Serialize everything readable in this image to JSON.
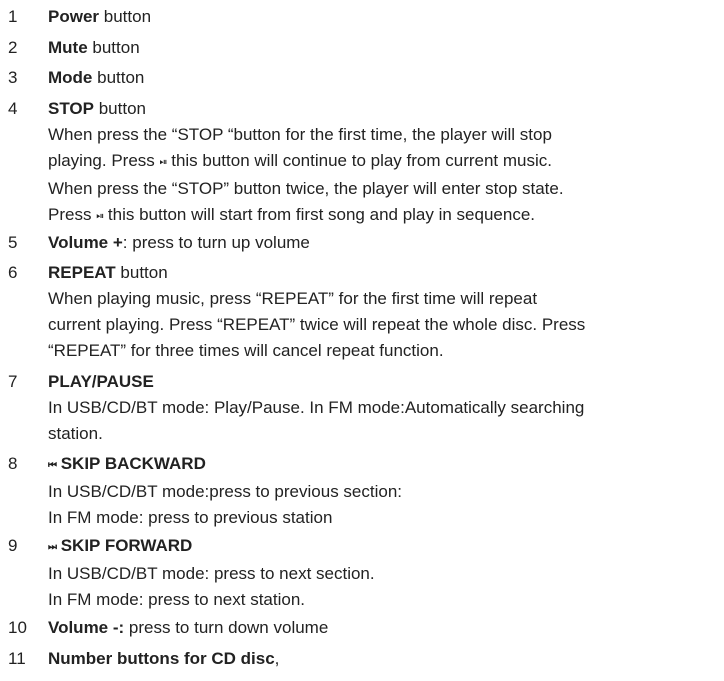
{
  "items": [
    {
      "num": "1",
      "bold": "Power",
      "rest": " button"
    },
    {
      "num": "2",
      "bold": "Mute",
      "rest": " button"
    },
    {
      "num": "3",
      "bold": "Mode",
      "rest": " button"
    },
    {
      "num": "4",
      "bold": "STOP",
      "rest": " button",
      "desc": [
        "When press the “STOP “button for the first time, the player will stop",
        [
          "playing. Press ",
          "⏯",
          " this button will continue to play from current music."
        ],
        " When press the “STOP” button twice, the player will enter stop state.",
        [
          "Press ",
          "⏯",
          " this button will start from first song and play in sequence."
        ]
      ]
    },
    {
      "num": "5",
      "bold": "Volume +",
      "rest": ": press to turn up volume"
    },
    {
      "num": "6",
      "bold": "REPEAT",
      "rest": " button",
      "desc": [
        "When playing music, press “REPEAT” for the first time will repeat",
        "current playing. Press “REPEAT” twice will repeat the whole disc. Press",
        "“REPEAT” for three times will cancel repeat function."
      ]
    },
    {
      "num": "7",
      "bold": "PLAY/PAUSE",
      "rest": "",
      "desc": [
        "In USB/CD/BT mode: Play/Pause. In FM mode:Automatically searching",
        "station."
      ]
    },
    {
      "num": "8",
      "icon": "⏮",
      "bold": " SKIP BACKWARD",
      "rest": "",
      "desc": [
        "In USB/CD/BT mode:press to previous section:",
        "In FM mode: press to previous station"
      ]
    },
    {
      "num": "9",
      "icon": "⏭",
      "bold": " SKIP FORWARD",
      "rest": "",
      "desc": [
        "In USB/CD/BT mode: press to next section.",
        "In FM mode: press to next station."
      ]
    },
    {
      "num": "10",
      "bold": "Volume -:",
      "rest": " press to turn down volume"
    },
    {
      "num": "11",
      "bold": "Number buttons for CD disc",
      "rest": ","
    }
  ]
}
